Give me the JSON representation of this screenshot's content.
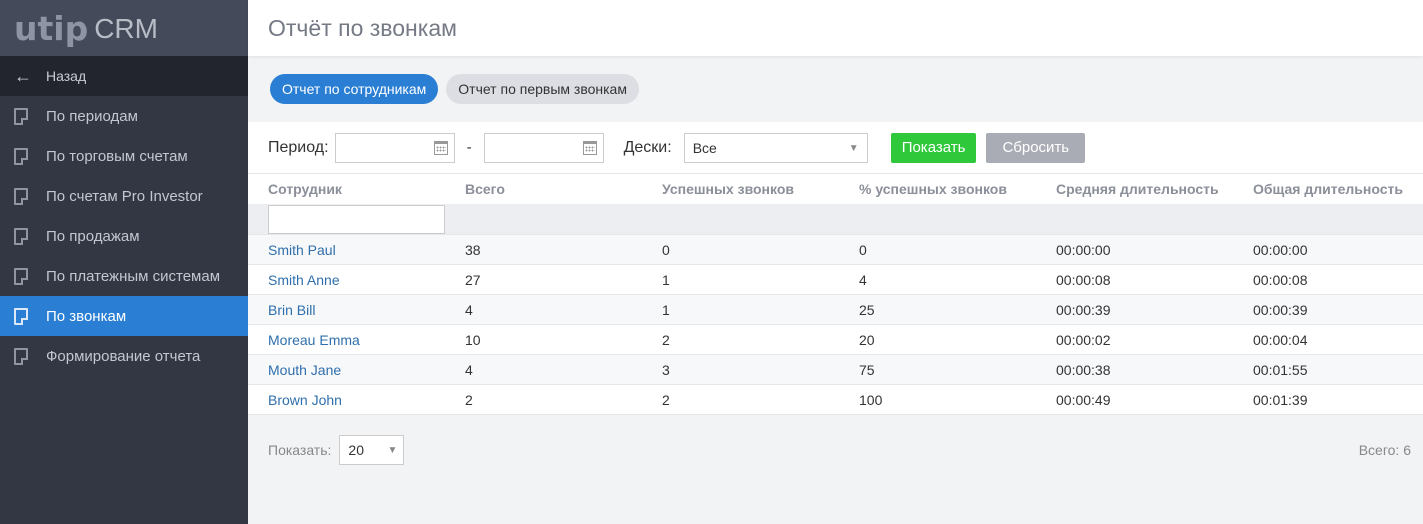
{
  "logo": {
    "utip": "utip",
    "crm": "CRM"
  },
  "sidebar": {
    "back_label": "Назад",
    "items": [
      {
        "label": "По периодам",
        "active": false
      },
      {
        "label": "По торговым счетам",
        "active": false
      },
      {
        "label": "По счетам Pro Investor",
        "active": false
      },
      {
        "label": "По продажам",
        "active": false
      },
      {
        "label": "По платежным системам",
        "active": false
      },
      {
        "label": "По звонкам",
        "active": true
      },
      {
        "label": "Формирование отчета",
        "active": false
      }
    ]
  },
  "header": {
    "title": "Отчёт по звонкам"
  },
  "tabs": [
    {
      "label": "Отчет по сотрудникам",
      "active": true
    },
    {
      "label": "Отчет по первым звонкам",
      "active": false
    }
  ],
  "filters": {
    "period_label": "Период:",
    "date_from": "",
    "date_to": "",
    "dash": "-",
    "desks_label": "Дески:",
    "desks_value": "Все",
    "show_button": "Показать",
    "reset_button": "Сбросить"
  },
  "table": {
    "columns": [
      "Сотрудник",
      "Всего",
      "Успешных звонков",
      "% успешных звонков",
      "Средняя длительность",
      "Общая длительность"
    ],
    "search_value": "",
    "rows": [
      [
        "Smith Paul",
        "38",
        "0",
        "0",
        "00:00:00",
        "00:00:00"
      ],
      [
        "Smith Anne",
        "27",
        "1",
        "4",
        "00:00:08",
        "00:00:08"
      ],
      [
        "Brin Bill",
        "4",
        "1",
        "25",
        "00:00:39",
        "00:00:39"
      ],
      [
        "Moreau Emma",
        "10",
        "2",
        "20",
        "00:00:02",
        "00:00:04"
      ],
      [
        "Mouth Jane",
        "4",
        "3",
        "75",
        "00:00:38",
        "00:01:55"
      ],
      [
        "Brown John",
        "2",
        "2",
        "100",
        "00:00:49",
        "00:01:39"
      ]
    ]
  },
  "footer": {
    "show_label": "Показать:",
    "page_size": "20",
    "total": "Всего: 6"
  },
  "colors": {
    "sidebar_bg": "#333744",
    "accent": "#2a7fd4",
    "show_button": "#2ec83a",
    "reset_button": "#a9acb4",
    "link": "#2f6fad"
  }
}
